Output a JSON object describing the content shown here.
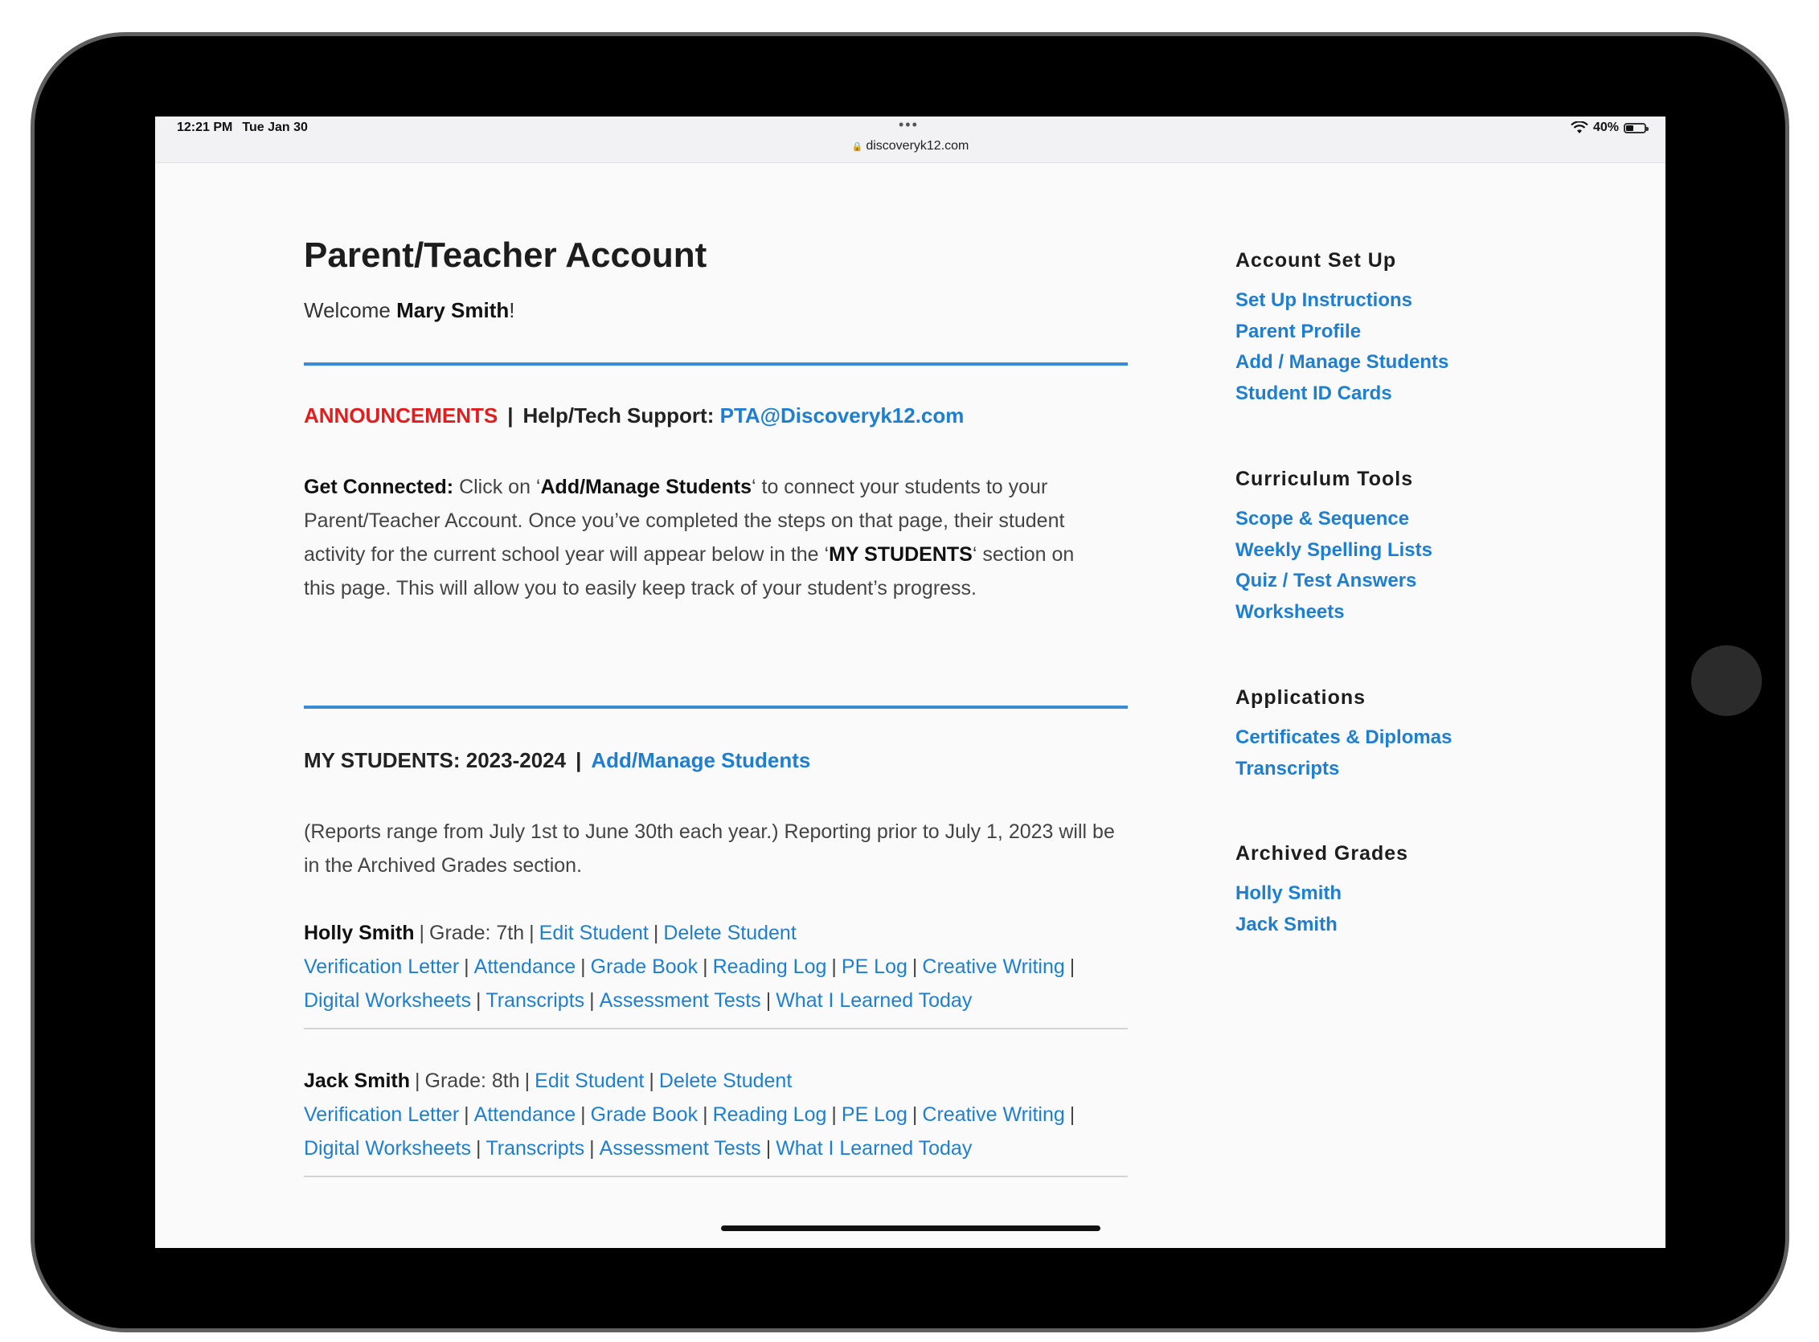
{
  "status_bar": {
    "time": "12:21 PM",
    "date": "Tue Jan 30",
    "url": "discoveryk12.com",
    "battery": "40%",
    "battery_level": 0.4
  },
  "main": {
    "title": "Parent/Teacher Account",
    "welcome_prefix": "Welcome ",
    "welcome_name": "Mary Smith",
    "welcome_suffix": "!",
    "announcements_label": "ANNOUNCEMENTS",
    "support_label": "Help/Tech Support:",
    "support_email": "PTA@Discoveryk12.com",
    "get_connected": {
      "label": "Get Connected:",
      "text1": " Click on ‘",
      "bold1": "Add/Manage Students",
      "text2": "‘ to connect your students to your Parent/Teacher Account. Once you’ve completed the steps on that page, their student activity for the current school year will appear below in the ‘",
      "bold2": "MY STUDENTS",
      "text3": "‘ section on this page. This will allow you to easily keep track of your student’s progress."
    },
    "my_students_label": "MY STUDENTS: 2023-2024",
    "manage_link": "Add/Manage Students",
    "reports_text": "(Reports range from July 1st to June 30th each year.) Reporting prior to July 1, 2023 will be in the Archived Grades section.",
    "students": [
      {
        "name": "Holly Smith",
        "grade": "Grade: 7th",
        "edit": "Edit Student",
        "delete": "Delete Student",
        "links": [
          "Verification Letter",
          "Attendance",
          "Grade Book",
          "Reading Log",
          "PE Log",
          "Creative Writing",
          "Digital Worksheets",
          "Transcripts",
          "Assessment Tests",
          "What I Learned Today"
        ]
      },
      {
        "name": "Jack Smith",
        "grade": "Grade: 8th",
        "edit": "Edit Student",
        "delete": "Delete Student",
        "links": [
          "Verification Letter",
          "Attendance",
          "Grade Book",
          "Reading Log",
          "PE Log",
          "Creative Writing",
          "Digital Worksheets",
          "Transcripts",
          "Assessment Tests",
          "What I Learned Today"
        ]
      }
    ]
  },
  "sidebar": {
    "account_setup": {
      "heading": "Account Set Up",
      "links": [
        "Set Up Instructions",
        "Parent Profile",
        "Add / Manage Students",
        "Student ID Cards"
      ]
    },
    "curriculum_tools": {
      "heading": "Curriculum Tools",
      "links": [
        "Scope & Sequence",
        "Weekly Spelling Lists",
        "Quiz / Test Answers",
        "Worksheets"
      ]
    },
    "applications": {
      "heading": "Applications",
      "links": [
        "Certificates & Diplomas",
        "Transcripts"
      ]
    },
    "archived_grades": {
      "heading": "Archived Grades",
      "links": [
        "Holly Smith",
        "Jack Smith"
      ]
    }
  },
  "colors": {
    "link": "#1e7fd1",
    "announcement": "#e21d1d",
    "divider": "#3a8ad8"
  }
}
